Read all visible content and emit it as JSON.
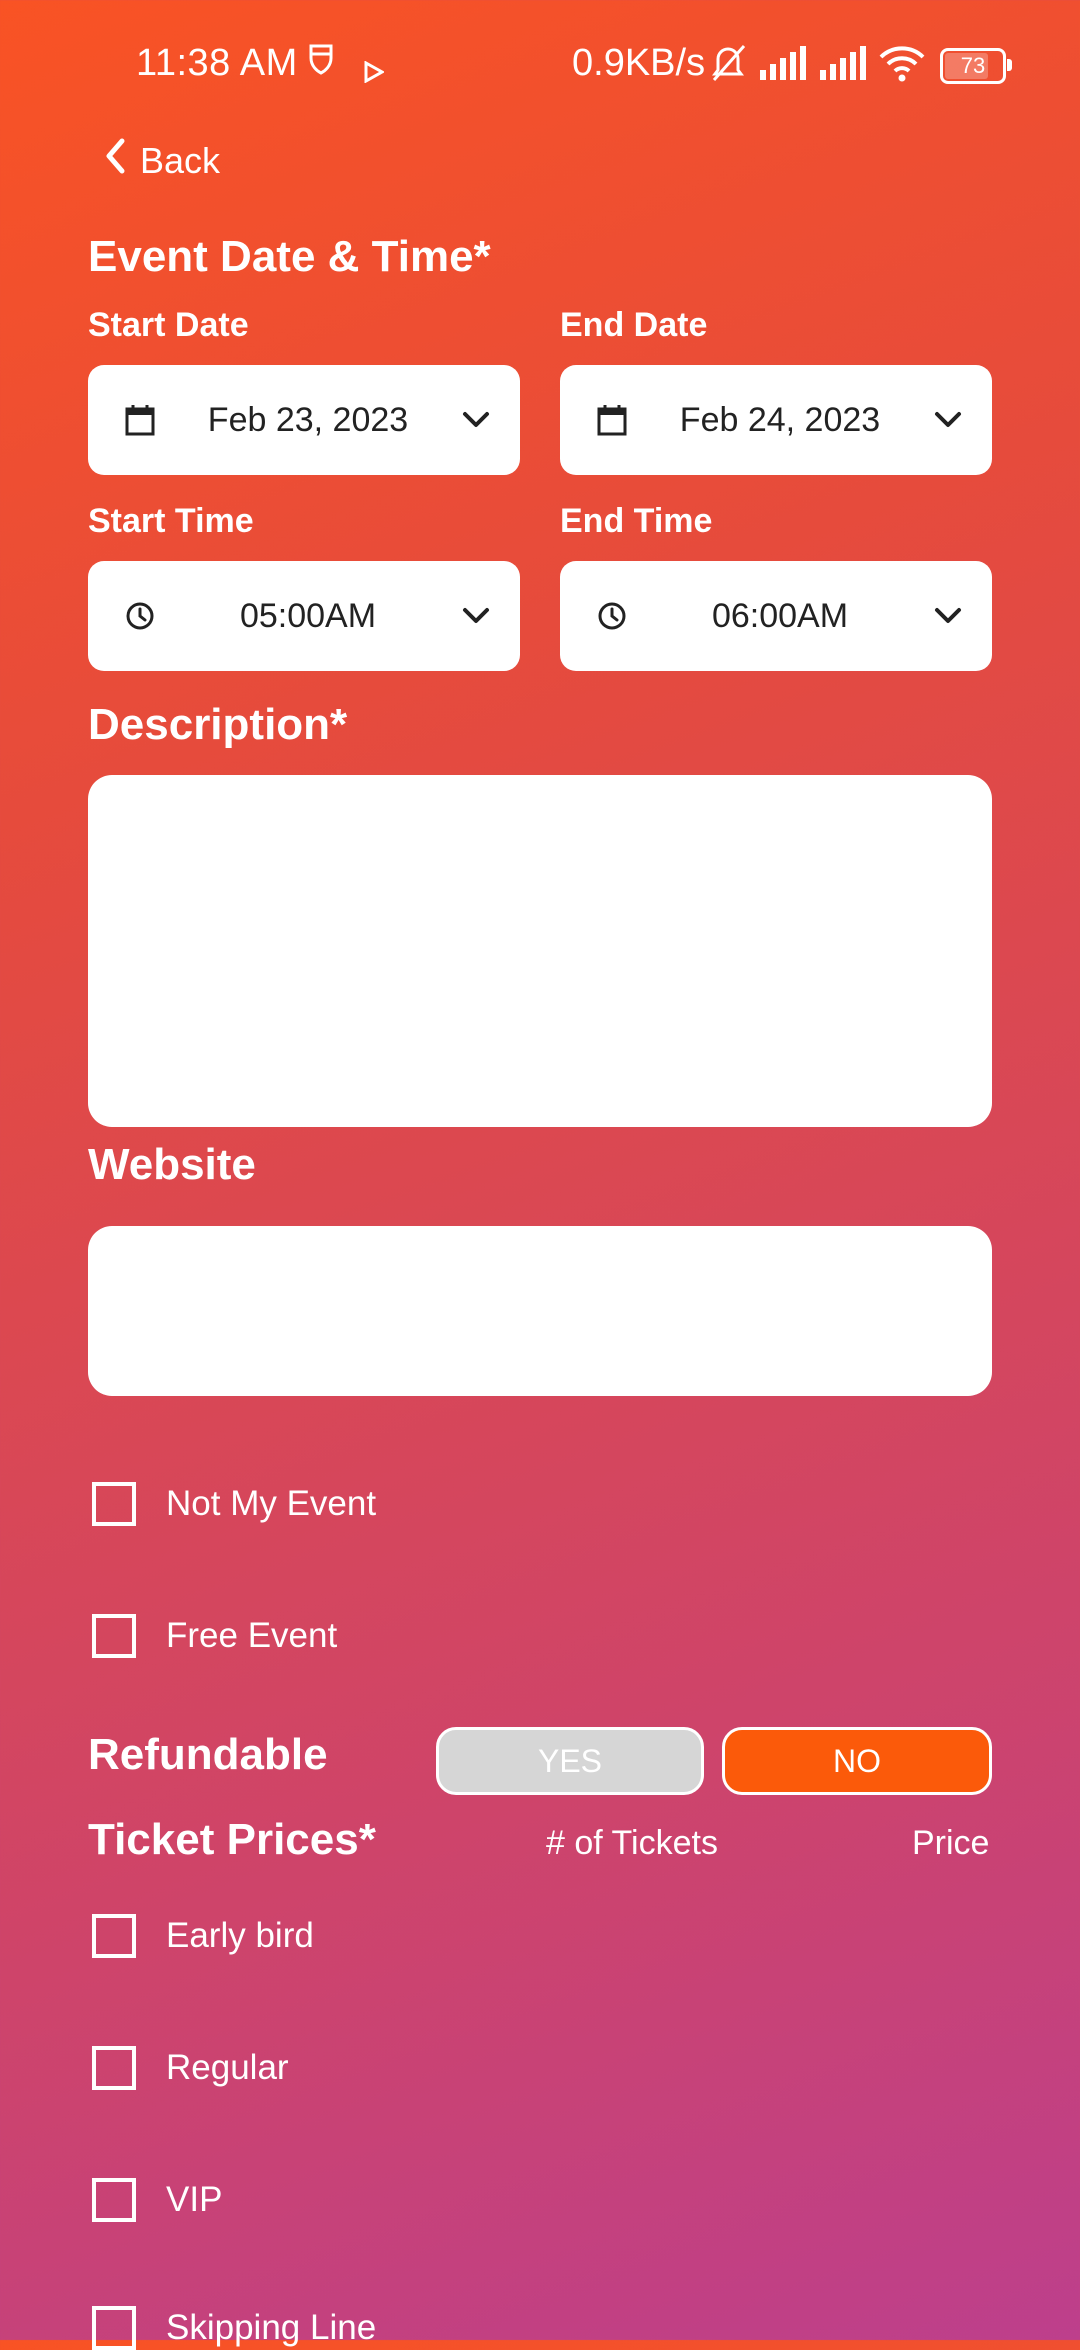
{
  "status_bar": {
    "time": "11:38 AM",
    "network_speed": "0.9KB/s",
    "battery_level": "73",
    "icons": [
      "shield-icon",
      "play-icon",
      "mute-bell-icon",
      "signal-icon",
      "signal-icon",
      "wifi-icon",
      "battery-icon"
    ]
  },
  "nav": {
    "back_label": "Back"
  },
  "event_datetime": {
    "heading": "Event Date & Time*",
    "start_date_label": "Start Date",
    "end_date_label": "End Date",
    "start_date": "Feb 23, 2023",
    "end_date": "Feb 24, 2023",
    "start_time_label": "Start Time",
    "end_time_label": "End Time",
    "start_time": "05:00AM",
    "end_time": "06:00AM"
  },
  "description": {
    "heading": "Description*",
    "value": ""
  },
  "website": {
    "heading": "Website",
    "value": ""
  },
  "options": {
    "not_my_event": "Not My Event",
    "free_event": "Free Event"
  },
  "refundable": {
    "label": "Refundable",
    "yes_label": "YES",
    "no_label": "NO",
    "selected": "NO"
  },
  "tickets": {
    "heading": "Ticket Prices*",
    "col_count": "# of Tickets",
    "col_price": "Price",
    "types": [
      "Early bird",
      "Regular",
      "VIP",
      "Skipping Line"
    ]
  },
  "colors": {
    "toggle_active": "#fb5a0a",
    "toggle_inactive": "#d6d6d6",
    "gradient_top": "#f95324",
    "gradient_bottom": "#bd3f8c"
  }
}
